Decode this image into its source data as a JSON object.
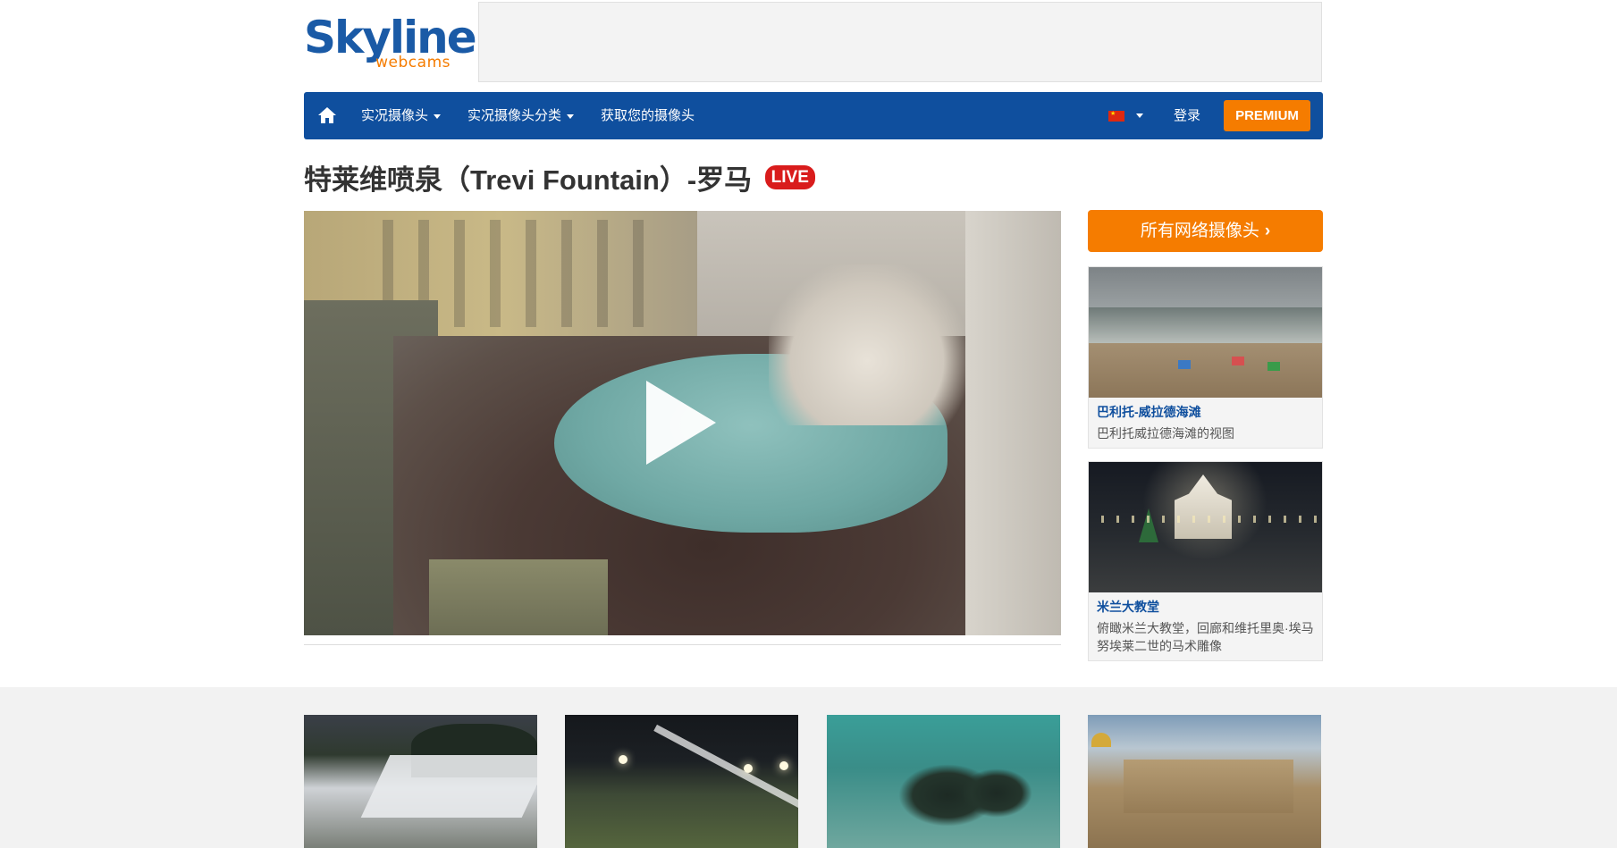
{
  "header": {
    "logo_main": "Skyline",
    "logo_sub": "webcams"
  },
  "nav": {
    "home_icon": "home-icon",
    "items": [
      {
        "label": "实况摄像头",
        "dropdown": true
      },
      {
        "label": "实况摄像头分类",
        "dropdown": true
      },
      {
        "label": "获取您的摄像头",
        "dropdown": false
      }
    ],
    "language_flag": "cn-flag-icon",
    "login_label": "登录",
    "premium_label": "PREMIUM"
  },
  "page": {
    "title": "特莱维喷泉（Trevi Fountain）-罗马",
    "live_badge": "LIVE"
  },
  "video": {
    "play_icon": "play-icon"
  },
  "sidebar": {
    "all_cams_label": "所有网络摄像头",
    "cards": [
      {
        "title": "巴利托-威拉德海滩",
        "desc": "巴利托威拉德海滩的视图"
      },
      {
        "title": "米兰大教堂",
        "desc": "俯瞰米兰大教堂，回廊和维托里奥·埃马努埃莱二世的马术雕像"
      }
    ]
  },
  "colors": {
    "brand_blue": "#0f4f9e",
    "accent_orange": "#f57c00",
    "live_red": "#d91c1c"
  }
}
